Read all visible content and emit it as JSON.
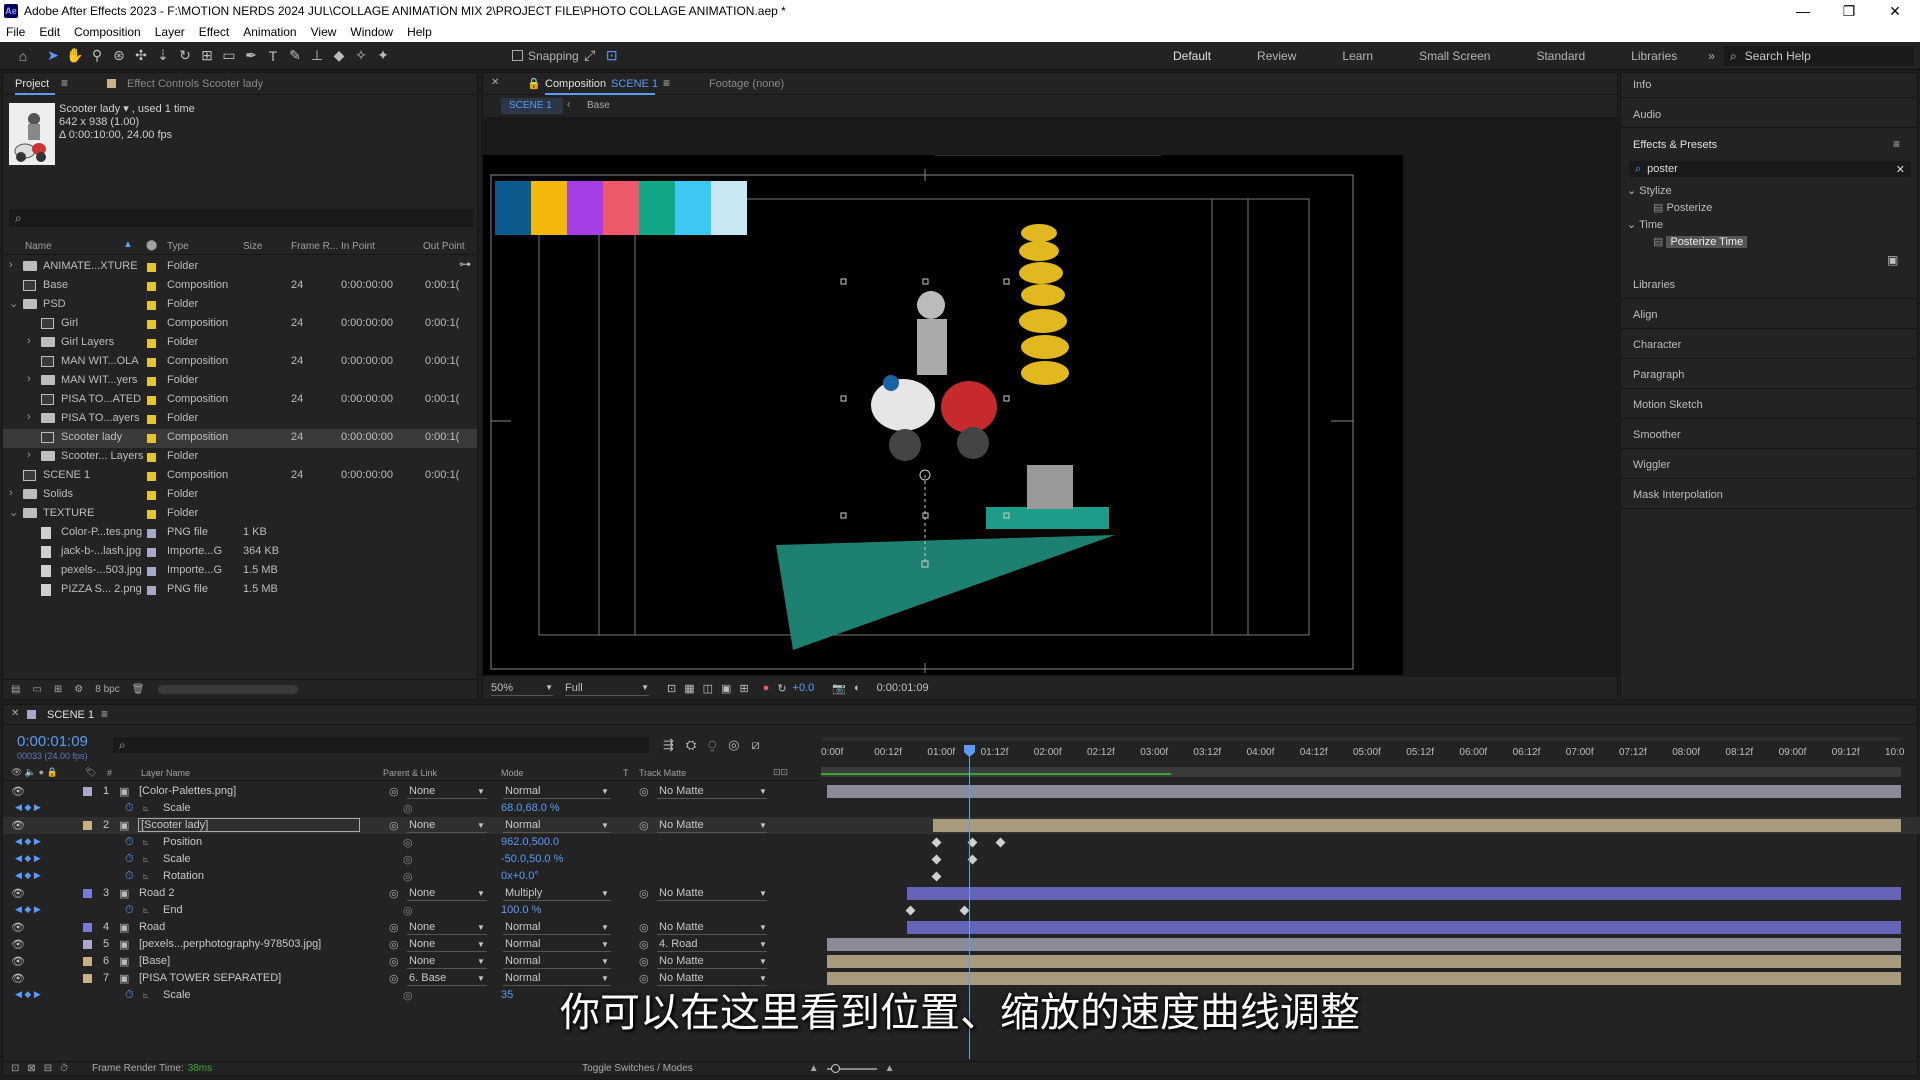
{
  "app": {
    "title": "Adobe After Effects 2023 - F:\\MOTION NERDS 2024 JUL\\COLLAGE ANIMATION MIX 2\\PROJECT FILE\\PHOTO COLLAGE ANIMATION.aep *",
    "logo": "Ae"
  },
  "menu": [
    "File",
    "Edit",
    "Composition",
    "Layer",
    "Effect",
    "Animation",
    "View",
    "Window",
    "Help"
  ],
  "toolbar": {
    "snapping": "Snapping",
    "workspaces": [
      "Default",
      "Review",
      "Learn",
      "Small Screen",
      "Standard",
      "Libraries"
    ],
    "search_help": "Search Help"
  },
  "project": {
    "tab": "Project",
    "effect_controls_tab": "Effect Controls Scooter lady",
    "item_name": "Scooter lady ▾ , used 1 time",
    "item_dims": "642 x 938 (1.00)",
    "item_duration": "Δ 0:00:10:00, 24.00 fps",
    "columns": [
      "Name",
      "Type",
      "Size",
      "Frame R...",
      "In Point",
      "Out Point"
    ],
    "rows": [
      {
        "name": "ANIMATE...XTURE",
        "type": "Folder",
        "size": "",
        "fr": "",
        "in": "",
        "out": "",
        "kind": "folder",
        "indent": 0,
        "tw": "›",
        "label": "#e3c534"
      },
      {
        "name": "Base",
        "type": "Composition",
        "size": "",
        "fr": "24",
        "in": "0:00:00:00",
        "out": "0:00:1(",
        "kind": "comp",
        "indent": 0,
        "tw": "",
        "label": "#e3c534"
      },
      {
        "name": "PSD",
        "type": "Folder",
        "size": "",
        "fr": "",
        "in": "",
        "out": "",
        "kind": "folder",
        "indent": 0,
        "tw": "⌄",
        "label": "#e3c534"
      },
      {
        "name": "Girl",
        "type": "Composition",
        "size": "",
        "fr": "24",
        "in": "0:00:00:00",
        "out": "0:00:1(",
        "kind": "comp",
        "indent": 1,
        "tw": "",
        "label": "#e3c534"
      },
      {
        "name": "Girl Layers",
        "type": "Folder",
        "size": "",
        "fr": "",
        "in": "",
        "out": "",
        "kind": "folder",
        "indent": 1,
        "tw": "›",
        "label": "#e3c534"
      },
      {
        "name": "MAN WIT...OLA",
        "type": "Composition",
        "size": "",
        "fr": "24",
        "in": "0:00:00:00",
        "out": "0:00:1(",
        "kind": "comp",
        "indent": 1,
        "tw": "",
        "label": "#e3c534"
      },
      {
        "name": "MAN WIT...yers",
        "type": "Folder",
        "size": "",
        "fr": "",
        "in": "",
        "out": "",
        "kind": "folder",
        "indent": 1,
        "tw": "›",
        "label": "#e3c534"
      },
      {
        "name": "PISA TO...ATED",
        "type": "Composition",
        "size": "",
        "fr": "24",
        "in": "0:00:00:00",
        "out": "0:00:1(",
        "kind": "comp",
        "indent": 1,
        "tw": "",
        "label": "#e3c534"
      },
      {
        "name": "PISA TO...ayers",
        "type": "Folder",
        "size": "",
        "fr": "",
        "in": "",
        "out": "",
        "kind": "folder",
        "indent": 1,
        "tw": "›",
        "label": "#e3c534"
      },
      {
        "name": "Scooter lady",
        "type": "Composition",
        "size": "",
        "fr": "24",
        "in": "0:00:00:00",
        "out": "0:00:1(",
        "kind": "comp",
        "indent": 1,
        "tw": "",
        "label": "#e3c534",
        "selected": true
      },
      {
        "name": "Scooter... Layers",
        "type": "Folder",
        "size": "",
        "fr": "",
        "in": "",
        "out": "",
        "kind": "folder",
        "indent": 1,
        "tw": "›",
        "label": "#e3c534"
      },
      {
        "name": "SCENE 1",
        "type": "Composition",
        "size": "",
        "fr": "24",
        "in": "0:00:00:00",
        "out": "0:00:1(",
        "kind": "comp",
        "indent": 0,
        "tw": "",
        "label": "#e3c534"
      },
      {
        "name": "Solids",
        "type": "Folder",
        "size": "",
        "fr": "",
        "in": "",
        "out": "",
        "kind": "folder",
        "indent": 0,
        "tw": "›",
        "label": "#e3c534"
      },
      {
        "name": "TEXTURE",
        "type": "Folder",
        "size": "",
        "fr": "",
        "in": "",
        "out": "",
        "kind": "folder",
        "indent": 0,
        "tw": "⌄",
        "label": "#e3c534"
      },
      {
        "name": "Color-P...tes.png",
        "type": "PNG file",
        "size": "1 KB",
        "fr": "",
        "in": "",
        "out": "",
        "kind": "file",
        "indent": 1,
        "tw": "",
        "label": "#a8a8c8"
      },
      {
        "name": "jack-b-...lash.jpg",
        "type": "Importe...G",
        "size": "364 KB",
        "fr": "",
        "in": "",
        "out": "",
        "kind": "file",
        "indent": 1,
        "tw": "",
        "label": "#a8a8c8"
      },
      {
        "name": "pexels-...503.jpg",
        "type": "Importe...G",
        "size": "1.5 MB",
        "fr": "",
        "in": "",
        "out": "",
        "kind": "file",
        "indent": 1,
        "tw": "",
        "label": "#a8a8c8"
      },
      {
        "name": "PIZZA S... 2.png",
        "type": "PNG file",
        "size": "1.5 MB",
        "fr": "",
        "in": "",
        "out": "",
        "kind": "file",
        "indent": 1,
        "tw": "",
        "label": "#a8a8c8"
      }
    ],
    "bpc": "8 bpc"
  },
  "composition": {
    "tab": "Composition",
    "tab_name": "SCENE 1",
    "footage_tab": "Footage (none)",
    "breadcrumbs": [
      "SCENE 1",
      "Base"
    ],
    "zoom": "50%",
    "resolution": "Full",
    "exposure": "+0.0",
    "timecode": "0:00:01:09",
    "palette_colors": [
      "#0d5a8e",
      "#f2b60c",
      "#a63ee6",
      "#ef5a6a",
      "#10a886",
      "#3cc8f0",
      "#c8e9f4"
    ]
  },
  "right": {
    "info": "Info",
    "audio": "Audio",
    "effects": "Effects & Presets",
    "search": "poster",
    "tree": [
      {
        "label": "Stylize",
        "child": "Posterize"
      },
      {
        "label": "Time",
        "child": "Posterize Time"
      }
    ],
    "panels": [
      "Libraries",
      "Align",
      "Character",
      "Paragraph",
      "Motion Sketch",
      "Smoother",
      "Wiggler",
      "Mask Interpolation"
    ]
  },
  "timeline": {
    "tab": "SCENE 1",
    "timecode": "0:00:01:09",
    "frames": "00033 (24.00 fps)",
    "headers": {
      "layer_name": "Layer Name",
      "parent": "Parent & Link",
      "mode": "Mode",
      "t": "T",
      "track_matte": "Track Matte"
    },
    "ruler": [
      "0:00f",
      "00:12f",
      "01:00f",
      "01:12f",
      "02:00f",
      "02:12f",
      "03:00f",
      "03:12f",
      "04:00f",
      "04:12f",
      "05:00f",
      "05:12f",
      "06:00f",
      "06:12f",
      "07:00f",
      "07:12f",
      "08:00f",
      "08:12f",
      "09:00f",
      "09:12f",
      "10:0"
    ],
    "rows": [
      {
        "num": "1",
        "name": "[Color-Palettes.png]",
        "parent": "None",
        "mode": "Normal",
        "matte": "No Matte",
        "label": "#a8a8c8",
        "type": "layer"
      },
      {
        "num": "",
        "name": "Scale",
        "value": "68.0,68.0 %",
        "type": "prop"
      },
      {
        "num": "2",
        "name": "[Scooter lady]",
        "parent": "None",
        "mode": "Normal",
        "matte": "No Matte",
        "label": "#c8b088",
        "type": "layer",
        "selected": true
      },
      {
        "num": "",
        "name": "Position",
        "value": "962.0,500.0",
        "type": "prop"
      },
      {
        "num": "",
        "name": "Scale",
        "value": "-50.0,50.0 %",
        "type": "prop"
      },
      {
        "num": "",
        "name": "Rotation",
        "value": "0x+0.0°",
        "type": "prop"
      },
      {
        "num": "3",
        "name": "Road 2",
        "parent": "None",
        "mode": "Multiply",
        "matte": "No Matte",
        "label": "#7a7ad8",
        "type": "layer"
      },
      {
        "num": "",
        "name": "End",
        "value": "100.0 %",
        "type": "prop"
      },
      {
        "num": "4",
        "name": "Road",
        "parent": "None",
        "mode": "Normal",
        "matte": "No Matte",
        "label": "#7a7ad8",
        "type": "layer"
      },
      {
        "num": "5",
        "name": "[pexels...perphotography-978503.jpg]",
        "parent": "None",
        "mode": "Normal",
        "matte": "4. Road",
        "label": "#a8a8c8",
        "type": "layer"
      },
      {
        "num": "6",
        "name": "[Base]",
        "parent": "None",
        "mode": "Normal",
        "matte": "No Matte",
        "label": "#c8b088",
        "type": "layer"
      },
      {
        "num": "7",
        "name": "[PISA TOWER SEPARATED]",
        "parent": "6. Base",
        "mode": "Normal",
        "matte": "No Matte",
        "label": "#c8b088",
        "type": "layer"
      },
      {
        "num": "",
        "name": "Scale",
        "value": "35",
        "type": "prop"
      }
    ],
    "render_time_label": "Frame Render Time:",
    "render_time": "38ms",
    "toggle": "Toggle Switches / Modes"
  },
  "subtitle": "你可以在这里看到位置、缩放的速度曲线调整"
}
